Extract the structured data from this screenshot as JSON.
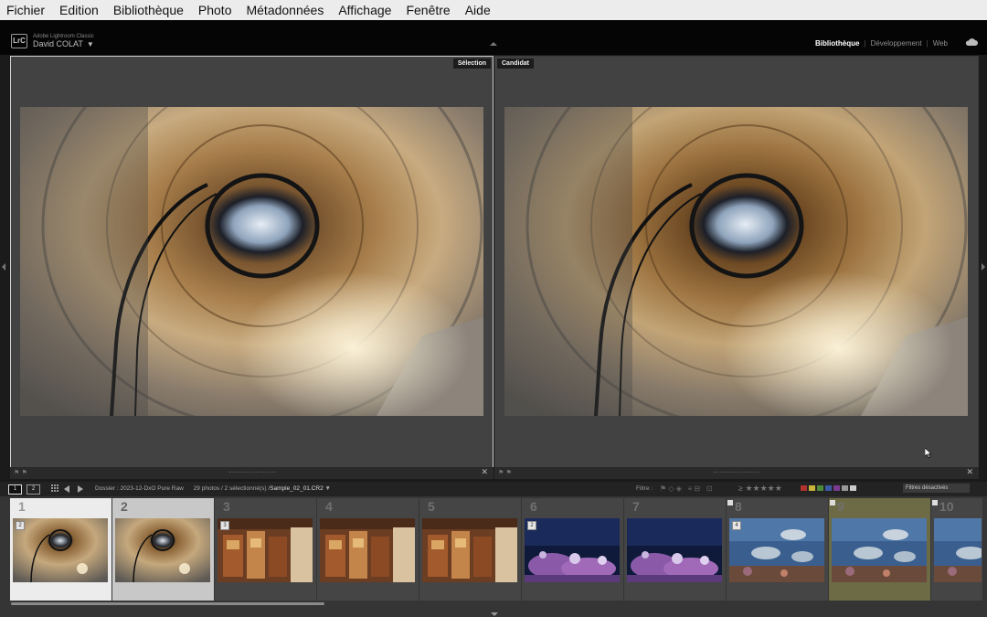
{
  "menu": [
    "Fichier",
    "Edition",
    "Bibliothèque",
    "Photo",
    "Métadonnées",
    "Affichage",
    "Fenêtre",
    "Aide"
  ],
  "identity": {
    "logo": "LrC",
    "app": "Adobe Lightroom Classic",
    "user": "David COLAT",
    "caret": "▼"
  },
  "modules": {
    "library": "Bibliothèque",
    "develop": "Développement",
    "web": "Web",
    "sep": "|"
  },
  "panes": {
    "select_label": "Sélection",
    "candidate_label": "Candidat",
    "close": "✕"
  },
  "toolbar": {
    "monitor1": "1",
    "monitor2": "2",
    "folder_prefix": "Dossier : 2023-12-DxO Pure Raw",
    "count": "29 photos / 2 sélectionné(s) /",
    "filename": "Sample_02_01.CR2",
    "filename_caret": "▼",
    "filter_label": "Filtre :",
    "stars": "≥ ★★★★★",
    "filters_off": "Filtres désactivés",
    "swatch_colors": [
      "#b0322d",
      "#c9b43a",
      "#4c8a3a",
      "#3a5aa3",
      "#7a3a8f",
      "#999999",
      "#cccccc"
    ]
  },
  "filmstrip": [
    {
      "num": "1",
      "badge": "2",
      "theme": "stair",
      "state": "sel-primary"
    },
    {
      "num": "2",
      "badge": "",
      "theme": "stair",
      "state": "sel-second"
    },
    {
      "num": "3",
      "badge": "3",
      "theme": "shop",
      "state": ""
    },
    {
      "num": "4",
      "badge": "",
      "theme": "shop",
      "state": ""
    },
    {
      "num": "5",
      "badge": "",
      "theme": "shop",
      "state": ""
    },
    {
      "num": "6",
      "badge": "2",
      "theme": "reef",
      "state": ""
    },
    {
      "num": "7",
      "badge": "",
      "theme": "reef",
      "state": ""
    },
    {
      "num": "8",
      "badge": "4",
      "theme": "fish",
      "state": ""
    },
    {
      "num": "9",
      "badge": "",
      "theme": "fish",
      "state": "label-yellow"
    },
    {
      "num": "10",
      "badge": "",
      "theme": "fish",
      "state": ""
    }
  ]
}
